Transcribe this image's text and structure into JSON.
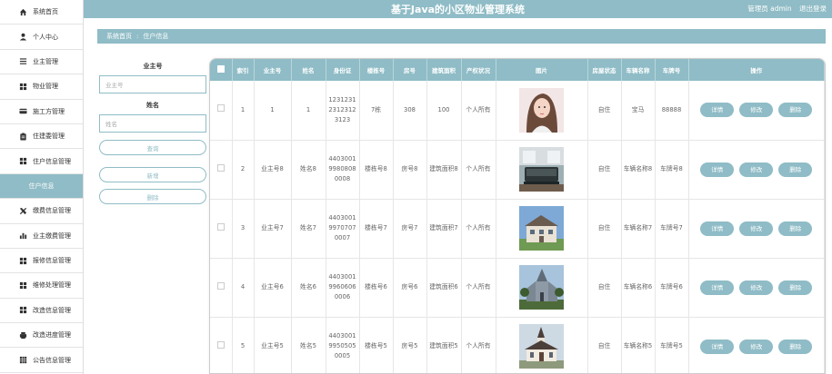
{
  "app": {
    "title": "基于Java的小区物业管理系统",
    "user_label": "管理员 admin",
    "logout_label": "退出登录"
  },
  "sidebar": {
    "items": [
      {
        "label": "系统首页",
        "icon": "home-icon"
      },
      {
        "label": "个人中心",
        "icon": "person-icon"
      },
      {
        "label": "业主管理",
        "icon": "list-icon"
      },
      {
        "label": "物业管理",
        "icon": "grid-icon"
      },
      {
        "label": "施工方管理",
        "icon": "card-icon"
      },
      {
        "label": "住建委管理",
        "icon": "clipboard-icon"
      },
      {
        "label": "住户信息管理",
        "icon": "grid-icon"
      },
      {
        "label": "住户信息",
        "icon": "",
        "sub": true
      },
      {
        "label": "缴费信息管理",
        "icon": "tools-icon"
      },
      {
        "label": "业主缴费管理",
        "icon": "bar-chart-icon"
      },
      {
        "label": "报修信息管理",
        "icon": "grid-icon"
      },
      {
        "label": "维修处理管理",
        "icon": "grid-icon"
      },
      {
        "label": "改造信息管理",
        "icon": "grid-icon"
      },
      {
        "label": "改造进度管理",
        "icon": "printer-icon"
      },
      {
        "label": "公告信息管理",
        "icon": "table-icon"
      }
    ]
  },
  "breadcrumb": {
    "home": "系统首页",
    "separator": ":",
    "current": "住户信息"
  },
  "search": {
    "owner_id_label": "业主号",
    "owner_id_placeholder": "业主号",
    "name_label": "姓名",
    "name_placeholder": "姓名",
    "query_button": "查询",
    "add_button": "新增",
    "delete_button": "删除"
  },
  "table": {
    "columns": [
      "索引",
      "业主号",
      "姓名",
      "身份证",
      "楼栋号",
      "房号",
      "建筑面积",
      "产权状况",
      "图片",
      "房屋状态",
      "车辆名称",
      "车牌号",
      "操作"
    ],
    "detail_label": "详情",
    "edit_label": "修改",
    "delete_label": "删除",
    "rows": [
      {
        "index": "1",
        "owner_id": "1",
        "name": "1",
        "id_card": "123123123123123123",
        "building": "7栋",
        "room": "308",
        "area": "100",
        "property": "个人所有",
        "image": "portrait-photo",
        "status": "自住",
        "car_name": "宝马",
        "plate": "88888"
      },
      {
        "index": "2",
        "owner_id": "业主号8",
        "name": "姓名8",
        "id_card": "440300199808080008",
        "building": "楼栋号8",
        "room": "房号8",
        "area": "建筑面积8",
        "property": "个人所有",
        "image": "interior-photo",
        "status": "自住",
        "car_name": "车辆名称8",
        "plate": "车牌号8"
      },
      {
        "index": "3",
        "owner_id": "业主号7",
        "name": "姓名7",
        "id_card": "440300199707070007",
        "building": "楼栋号7",
        "room": "房号7",
        "area": "建筑面积7",
        "property": "个人所有",
        "image": "house-photo",
        "status": "自住",
        "car_name": "车辆名称7",
        "plate": "车牌号7"
      },
      {
        "index": "4",
        "owner_id": "业主号6",
        "name": "姓名6",
        "id_card": "440300199606060006",
        "building": "楼栋号6",
        "room": "房号6",
        "area": "建筑面积6",
        "property": "个人所有",
        "image": "church-photo",
        "status": "自住",
        "car_name": "车辆名称6",
        "plate": "车牌号6"
      },
      {
        "index": "5",
        "owner_id": "业主号5",
        "name": "姓名5",
        "id_card": "440300199505050005",
        "building": "楼栋号5",
        "room": "房号5",
        "area": "建筑面积5",
        "property": "个人所有",
        "image": "chapel-photo",
        "status": "自住",
        "car_name": "车辆名称5",
        "plate": "车牌号5"
      }
    ]
  },
  "colors": {
    "accent": "#8fbcc6",
    "text": "#666666"
  }
}
